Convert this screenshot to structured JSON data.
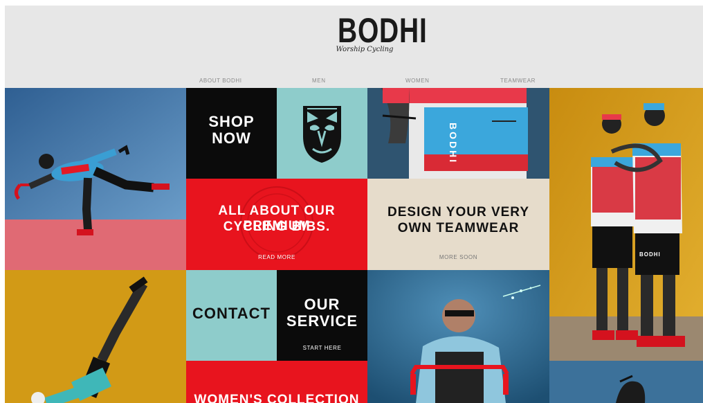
{
  "brand": {
    "name": "BODHI",
    "tagline": "Worship Cycling"
  },
  "nav": {
    "items": [
      "ABOUT BODHI",
      "MEN",
      "WOMEN",
      "TEAMWEAR"
    ]
  },
  "tiles": {
    "shop": {
      "line1": "SHOP",
      "line2": "NOW"
    },
    "bibs": {
      "line1": "ALL ABOUT OUR PREMIUM",
      "line2": "CYCLING BIBS.",
      "link": "READ MORE"
    },
    "teamwear": {
      "line1": "DESIGN YOUR VERY",
      "line2": "OWN TEAMWEAR",
      "link": "MORE SOON"
    },
    "contact": {
      "label": "CONTACT"
    },
    "service": {
      "line1": "OUR",
      "line2": "SERVICE",
      "link": "START HERE"
    },
    "womens": {
      "label": "WOMEN'S COLLECTION"
    }
  },
  "photo_labels": {
    "jersey_print": "BODHI",
    "bib_print": "BODHI"
  },
  "colors": {
    "red": "#e8141e",
    "aqua": "#8ecccb",
    "cream": "#e6dccb",
    "black": "#0b0b0b",
    "blue_photo": "#4a7fb0",
    "mustard": "#d8a21a"
  }
}
